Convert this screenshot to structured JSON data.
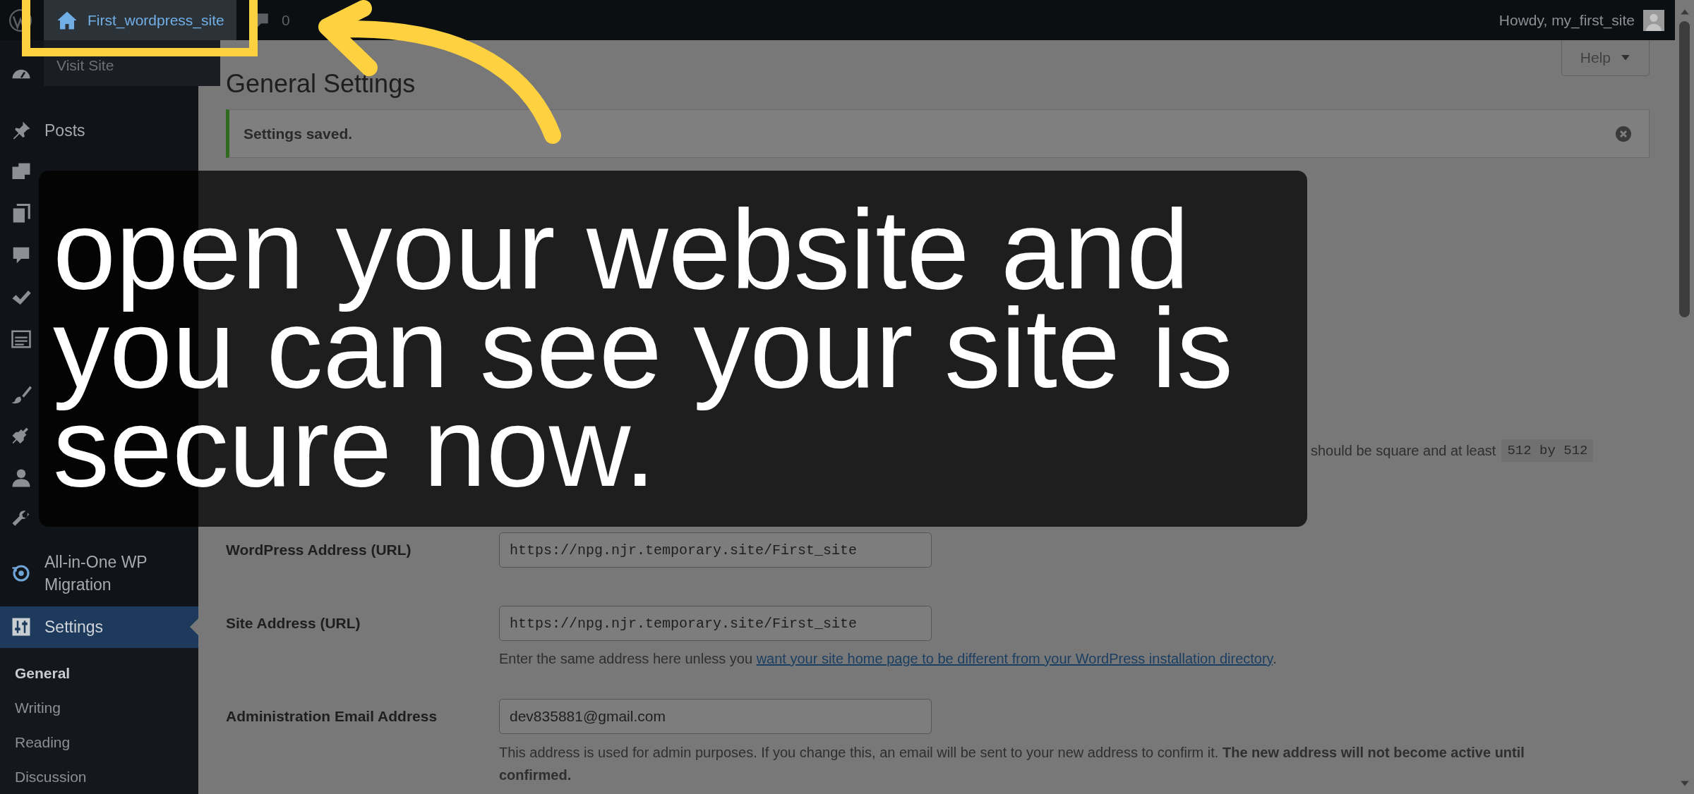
{
  "admin_bar": {
    "site_name": "First_wordpress_site",
    "comments_count": "0",
    "visit_site": "Visit Site",
    "greeting": "Howdy, my_first_site"
  },
  "sidebar": {
    "items": [
      {
        "label": "Posts",
        "selected": false
      },
      {
        "label": "All-in-One WP Migration",
        "selected": false
      },
      {
        "label": "Settings",
        "selected": true
      }
    ],
    "submenu": [
      {
        "label": "General",
        "selected": true
      },
      {
        "label": "Writing",
        "selected": false
      },
      {
        "label": "Reading",
        "selected": false
      },
      {
        "label": "Discussion",
        "selected": false
      }
    ]
  },
  "help_button": "Help",
  "page_title": "General Settings",
  "notice": {
    "text": "Settings saved."
  },
  "site_icon_note": {
    "text": "should be square and at least",
    "size": "512 by 512"
  },
  "fields": [
    {
      "label": "WordPress Address (URL)",
      "value": "https://npg.njr.temporary.site/First_site",
      "kind": "mono"
    },
    {
      "label": "Site Address (URL)",
      "value": "https://npg.njr.temporary.site/First_site",
      "kind": "mono",
      "hint": {
        "before": "Enter the same address here unless you ",
        "link": "want your site home page to be different from your WordPress installation directory",
        "after": "."
      }
    },
    {
      "label": "Administration Email Address",
      "value": "dev835881@gmail.com",
      "kind": "text",
      "description": "This address is used for admin purposes. If you change this, an email will be sent to your new address to confirm it. **The new address will not become active until confirmed.**"
    }
  ],
  "caption": "open your website and you can see your site is secure now."
}
